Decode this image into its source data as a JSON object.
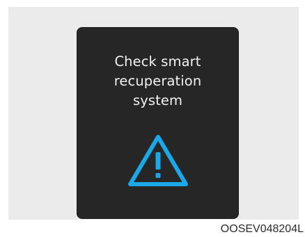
{
  "display": {
    "message_lines": [
      "Check smart",
      "recuperation",
      "system"
    ],
    "warning_icon": "warning-triangle-icon",
    "accent_color": "#1aa8e8",
    "text_color": "#f2f2f2",
    "screen_color": "#262626"
  },
  "figure_code": "OOSEV048204L"
}
